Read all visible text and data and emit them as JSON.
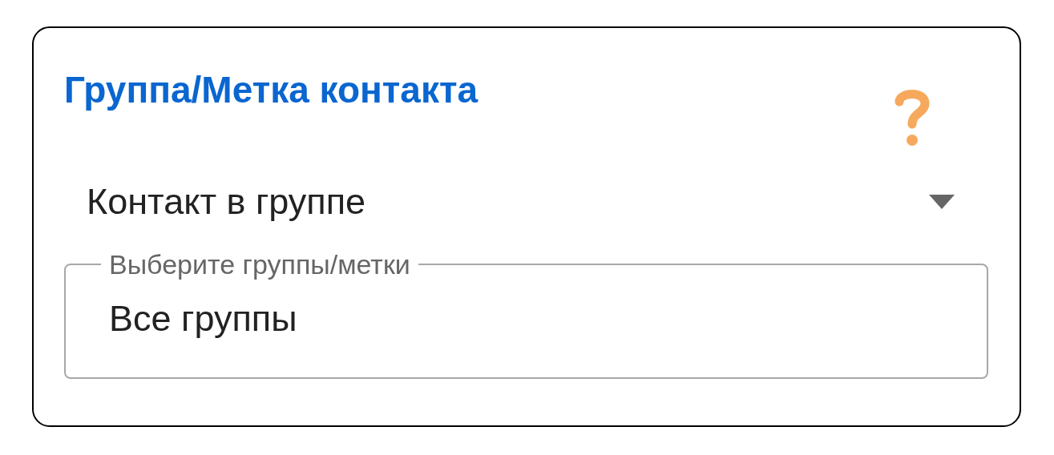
{
  "title": "Группа/Метка контакта",
  "dropdown": {
    "value": "Контакт в группе"
  },
  "groups_field": {
    "label": "Выберите группы/метки",
    "value": "Все группы"
  }
}
